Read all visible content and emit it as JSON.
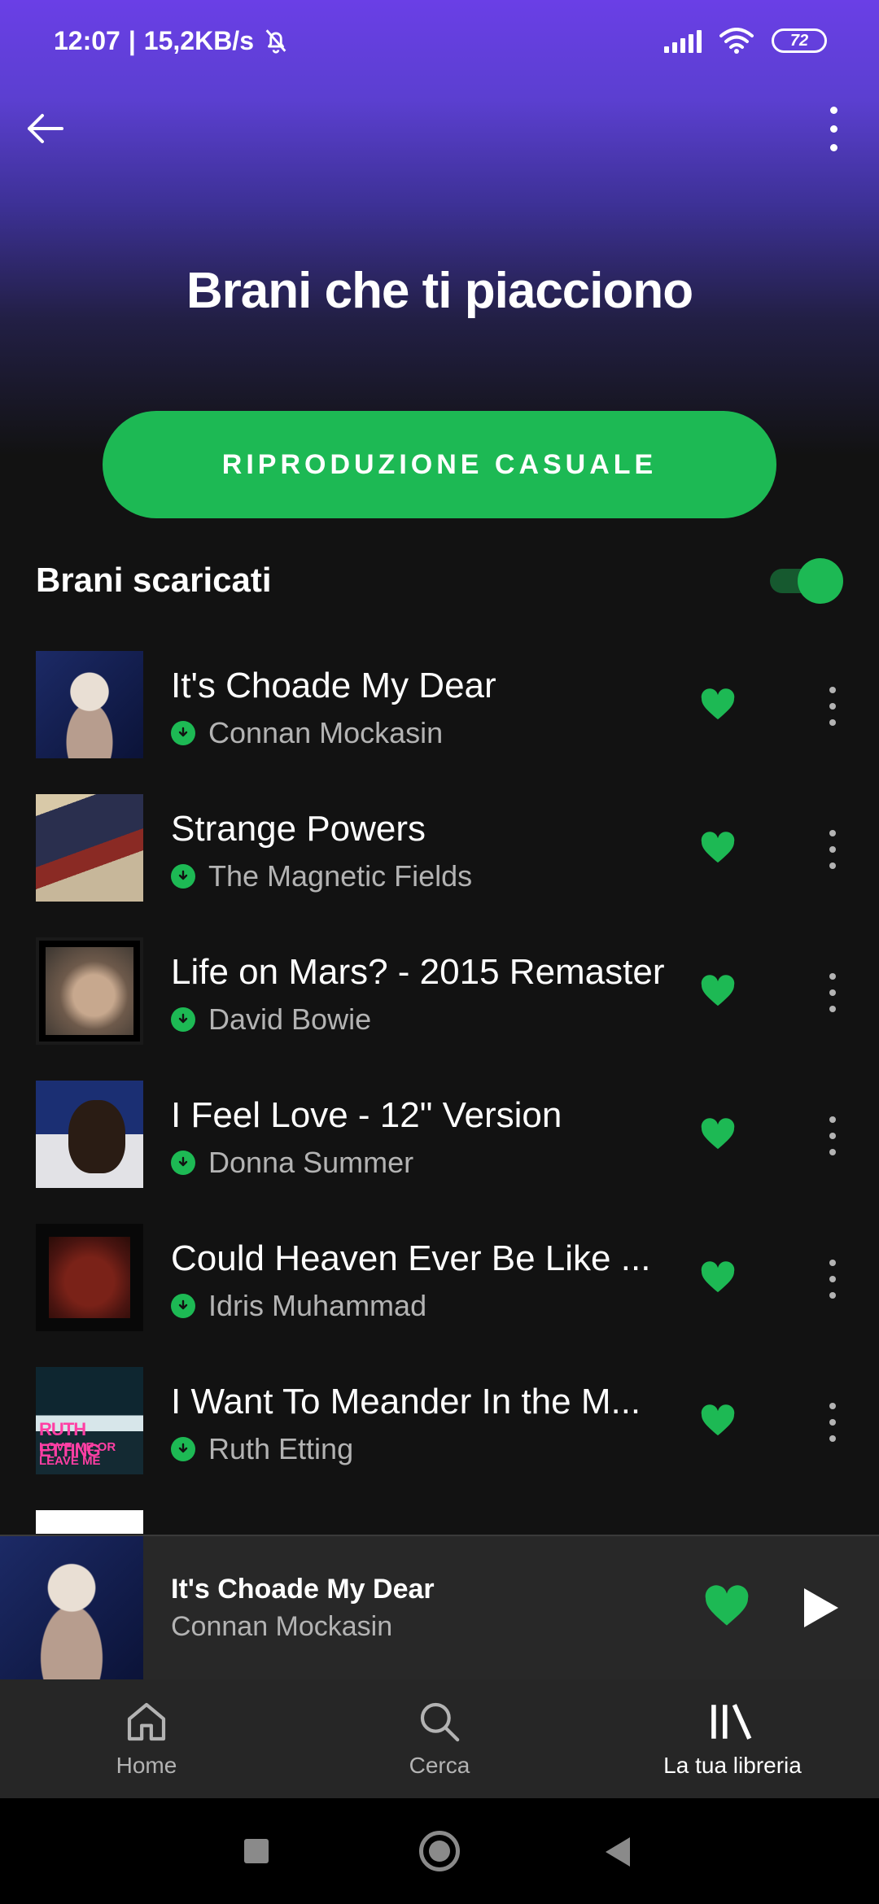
{
  "status_bar": {
    "time": "12:07",
    "separator": "|",
    "network_speed": "15,2KB/s",
    "battery": "72",
    "icons": [
      "silent-bell-icon",
      "signal-icon",
      "wifi-icon",
      "battery-icon"
    ]
  },
  "header": {
    "title": "Brani che ti piacciono",
    "back_icon": "back-arrow-icon",
    "more_icon": "more-vertical-icon"
  },
  "shuffle_button": {
    "label": "RIPRODUZIONE CASUALE"
  },
  "downloaded": {
    "label": "Brani scaricati",
    "toggle_on": true
  },
  "tracks": [
    {
      "title": "It's Choade My Dear",
      "artist": "Connan Mockasin",
      "liked": true,
      "downloaded": true
    },
    {
      "title": "Strange Powers",
      "artist": "The Magnetic Fields",
      "liked": true,
      "downloaded": true
    },
    {
      "title": "Life on Mars? - 2015 Remaster",
      "artist": "David Bowie",
      "liked": true,
      "downloaded": true
    },
    {
      "title": "I Feel Love - 12\" Version",
      "artist": "Donna Summer",
      "liked": true,
      "downloaded": true
    },
    {
      "title": "Could Heaven Ever Be Like ...",
      "artist": "Idris Muhammad",
      "liked": true,
      "downloaded": true
    },
    {
      "title": "I Want To Meander In the M...",
      "artist": "Ruth Etting",
      "liked": true,
      "downloaded": true
    }
  ],
  "art_text": {
    "ruth_line1": "RUTH ETTING",
    "ruth_line2": "LOVE ME OR LEAVE ME"
  },
  "mini_player": {
    "title": "It's Choade My Dear",
    "artist": "Connan Mockasin",
    "liked": true,
    "state": "paused"
  },
  "bottom_nav": [
    {
      "label": "Home",
      "icon": "home-icon",
      "active": false
    },
    {
      "label": "Cerca",
      "icon": "search-icon",
      "active": false
    },
    {
      "label": "La tua libreria",
      "icon": "library-icon",
      "active": true
    }
  ],
  "colors": {
    "accent": "#1db954",
    "background": "#121212",
    "header_gradient_top": "#6a3fe6",
    "secondary_text": "#b3b3b3"
  }
}
